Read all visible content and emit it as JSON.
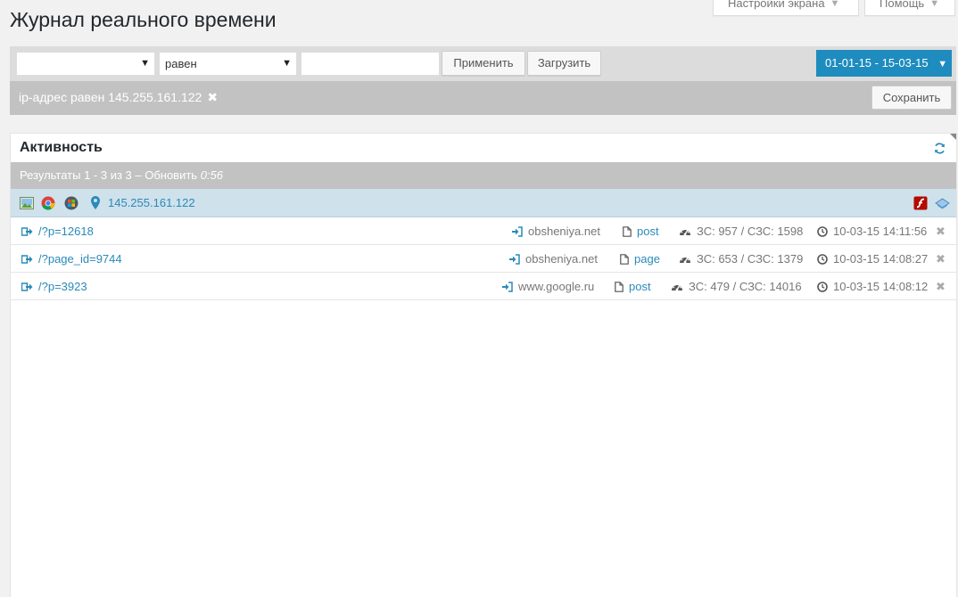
{
  "screen_tabs": {
    "settings": "Настройки экрана",
    "help": "Помощь"
  },
  "page_title": "Журнал реального времени",
  "filter": {
    "field_select": "",
    "operator_select": "равен",
    "value_input": "",
    "apply_label": "Применить",
    "load_label": "Загрузить",
    "date_range": "01-01-15 - 15-03-15"
  },
  "active_filter": {
    "label": "ip-адрес равен 145.255.161.122",
    "save_label": "Сохранить"
  },
  "panel": {
    "title": "Активность",
    "results_text": "Результаты 1 - 3 из 3 – Обновить ",
    "refresh_countdown": "0:56",
    "visitor_ip": "145.255.161.122"
  },
  "hits": [
    {
      "url": "/?p=12618",
      "referrer": "obsheniya.net",
      "type": "post",
      "stats": "ЗС: 957 / СЗС: 1598",
      "time": "10-03-15 14:11:56"
    },
    {
      "url": "/?page_id=9744",
      "referrer": "obsheniya.net",
      "type": "page",
      "stats": "ЗС: 653 / СЗС: 1379",
      "time": "10-03-15 14:08:27"
    },
    {
      "url": "/?p=3923",
      "referrer": "www.google.ru",
      "type": "post",
      "stats": "ЗС: 479 / СЗС: 14016",
      "time": "10-03-15 14:08:12"
    }
  ],
  "colors": {
    "accent": "#1e8cbe",
    "link": "#2a8ab8",
    "bar_gray": "#c2c2c2",
    "visitor_row": "#cfe1eb"
  }
}
